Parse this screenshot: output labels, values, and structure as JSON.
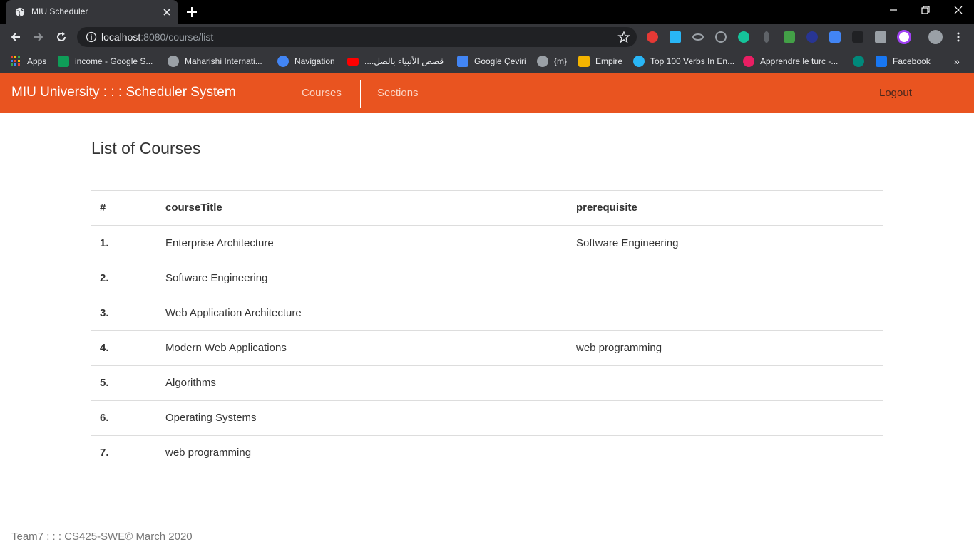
{
  "browser": {
    "tab_title": "MIU Scheduler",
    "url_host": "localhost",
    "url_rest": ":8080/course/list",
    "bookmarks": [
      {
        "label": "Apps",
        "color": "#ea4335"
      },
      {
        "label": "income - Google S...",
        "color": "#0f9d58"
      },
      {
        "label": "Maharishi Internati...",
        "color": "#9aa0a6"
      },
      {
        "label": "Navigation",
        "color": "#4285f4"
      },
      {
        "label": "....قصص الأنبياء بالصل",
        "color": "#ff0000"
      },
      {
        "label": "Google Çeviri",
        "color": "#4285f4"
      },
      {
        "label": "{m}",
        "color": "#9aa0a6"
      },
      {
        "label": "Empire",
        "color": "#f4b400"
      },
      {
        "label": "Top 100 Verbs In En...",
        "color": "#29b6f6"
      },
      {
        "label": "Apprendre le turc -...",
        "color": "#e91e63"
      },
      {
        "label": "",
        "color": "#00897b"
      },
      {
        "label": "Facebook",
        "color": "#1877f2"
      }
    ],
    "more_bookmarks": "»"
  },
  "app": {
    "brand": "MIU University : : : Scheduler System",
    "nav": {
      "courses": "Courses",
      "sections": "Sections"
    },
    "logout": "Logout",
    "accent": "#e95420"
  },
  "page": {
    "title": "List of Courses",
    "table": {
      "headers": {
        "num": "#",
        "title": "courseTitle",
        "prerequisite": "prerequisite"
      },
      "rows": [
        {
          "num": "1.",
          "title": "Enterprise Architecture",
          "prerequisite": "Software Engineering"
        },
        {
          "num": "2.",
          "title": "Software Engineering",
          "prerequisite": ""
        },
        {
          "num": "3.",
          "title": "Web Application Architecture",
          "prerequisite": ""
        },
        {
          "num": "4.",
          "title": "Modern Web Applications",
          "prerequisite": "web programming"
        },
        {
          "num": "5.",
          "title": "Algorithms",
          "prerequisite": ""
        },
        {
          "num": "6.",
          "title": "Operating Systems",
          "prerequisite": ""
        },
        {
          "num": "7.",
          "title": "web programming",
          "prerequisite": ""
        }
      ]
    }
  },
  "footer": "Team7 : : : CS425-SWE© March 2020"
}
